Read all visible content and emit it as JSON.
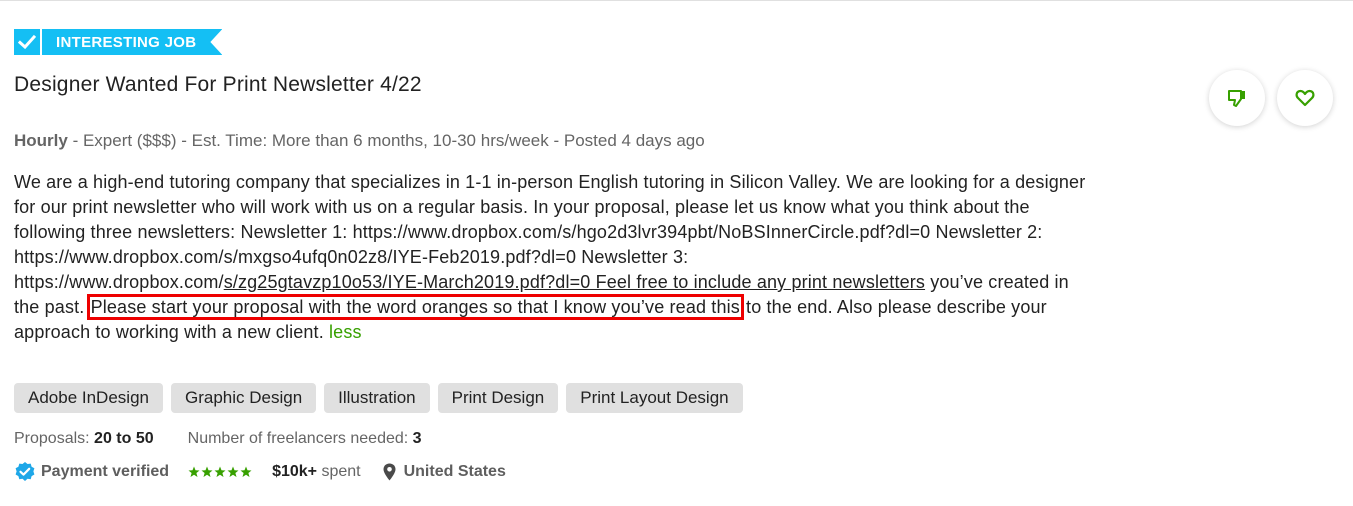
{
  "badge": {
    "label": "INTERESTING JOB",
    "icon": "checkmark-icon",
    "color": "#14bff4"
  },
  "job": {
    "title": "Designer Wanted For Print Newsletter 4/22",
    "meta": {
      "type": "Hourly",
      "rest": " - Expert ($$$) - Est. Time: More than 6 months, 10-30 hrs/week - Posted 4 days ago"
    },
    "description": {
      "part1": "We are a high-end tutoring company that specializes in 1-1 in-person English tutoring in Silicon Valley. We are looking for a designer for our print newsletter who will work with us on a regular basis. In your proposal, please let us know what you think about the following three newsletters: Newsletter 1: https://www.dropbox.com/s/hgo2d3lvr394pbt/NoBSInnerCircle.pdf?dl=0 Newsletter 2: https://www.dropbox.com/s/mxgso4ufq0n02z8/IYE-Feb2019.pdf?dl=0 Newsletter 3: https://www.dropbox.com/",
      "underlined": "s/zg25gtavzp10o53/IYE-March2019.pdf?dl=0 Feel free to include any print newsletters",
      "part2": " you’ve created in the past. ",
      "highlighted": "Please start your proposal with the word oranges so that I know you’ve read this",
      "part3": " to the end. Also please describe your approach to working with a new client. ",
      "less_label": "less"
    },
    "skills": [
      "Adobe InDesign",
      "Graphic Design",
      "Illustration",
      "Print Design",
      "Print Layout Design"
    ],
    "proposals_label": "Proposals: ",
    "proposals_value": "20 to 50",
    "freelancers_label": "Number of freelancers needed: ",
    "freelancers_value": "3"
  },
  "client": {
    "payment_verified": "Payment verified",
    "rating_stars": 5,
    "spent_value": "$10k+",
    "spent_label": " spent",
    "location": "United States"
  },
  "actions": {
    "dislike_icon": "thumbs-down-icon",
    "save_icon": "heart-icon"
  },
  "colors": {
    "accent_green": "#37a000",
    "badge_blue": "#14bff4",
    "highlight_red": "#ee0000",
    "verified_blue": "#1ea7e8"
  }
}
